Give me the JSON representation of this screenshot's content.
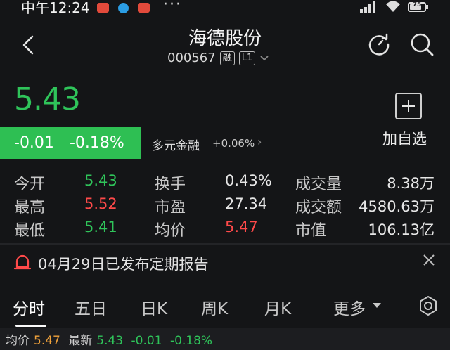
{
  "status_bar": {
    "time": "中午12:24",
    "dots": "···",
    "battery": "75"
  },
  "header": {
    "title": "海德股份",
    "code": "000567",
    "tag_margin": "融",
    "tag_level": "L1"
  },
  "quote": {
    "price": "5.43",
    "change": "-0.01",
    "change_pct": "-0.18%",
    "concept_name": "多元金融",
    "concept_change": "+0.06%",
    "add_watchlist": "加自选"
  },
  "stats": [
    {
      "label": "今开",
      "value": "5.43",
      "color": "green"
    },
    {
      "label": "换手",
      "value": "0.43%",
      "color": "white"
    },
    {
      "label": "成交量",
      "value": "8.38万",
      "color": "white"
    },
    {
      "label": "最高",
      "value": "5.52",
      "color": "red"
    },
    {
      "label": "市盈",
      "value": "27.34",
      "color": "white"
    },
    {
      "label": "成交额",
      "value": "4580.63万",
      "color": "white"
    },
    {
      "label": "最低",
      "value": "5.41",
      "color": "green"
    },
    {
      "label": "均价",
      "value": "5.47",
      "color": "red"
    },
    {
      "label": "市值",
      "value": "106.13亿",
      "color": "white"
    }
  ],
  "notice": {
    "text": "04月29日已发布定期报告"
  },
  "tabs": [
    "分时",
    "五日",
    "日K",
    "周K",
    "月K",
    "更多"
  ],
  "bottom": {
    "avg_label": "均价",
    "avg_value": "5.47",
    "latest_label": "最新",
    "latest_value": "5.43",
    "change": "-0.01",
    "change_pct": "-0.18%"
  },
  "colors": {
    "up": "#ff4a4a",
    "down": "#2fc45a",
    "background": "#141517"
  }
}
